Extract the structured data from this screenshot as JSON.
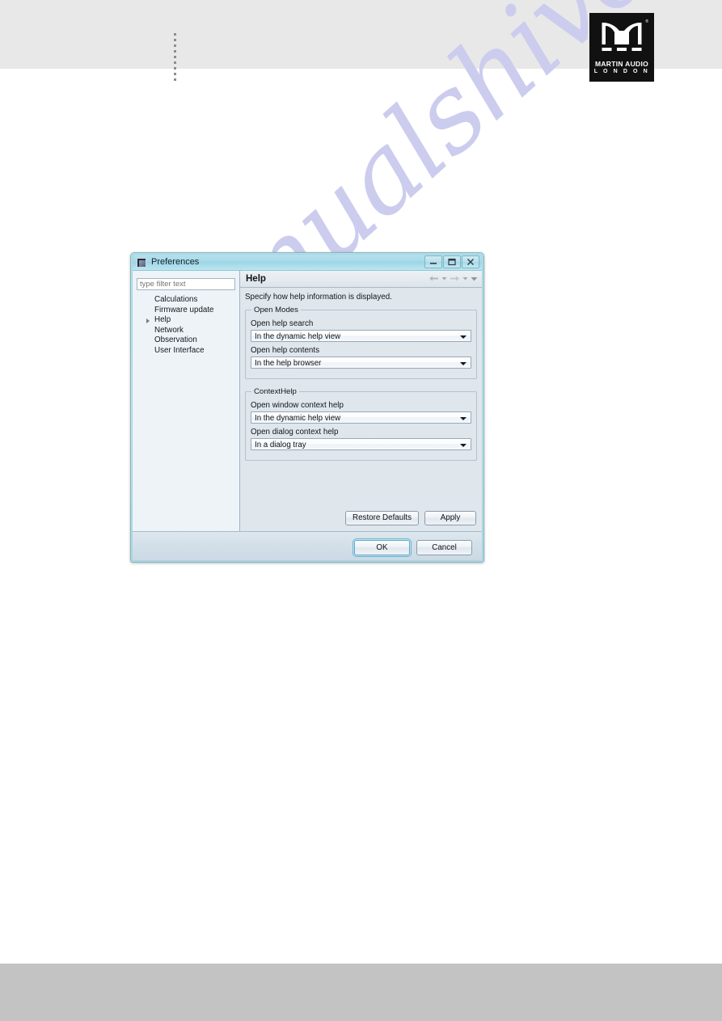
{
  "page": {
    "logo": {
      "brand": "MARTIN AUDIO",
      "city": "L O N D O N",
      "registered_mark": "®"
    },
    "watermark": "manualshive.com"
  },
  "dialog": {
    "title": "Preferences",
    "window_buttons": [
      {
        "name": "minimize",
        "label": "Minimize"
      },
      {
        "name": "maximize",
        "label": "Maximize"
      },
      {
        "name": "close",
        "label": "Close"
      }
    ],
    "sidebar": {
      "filter_placeholder": "type filter text",
      "filter_value": "type filter text",
      "items": [
        {
          "label": "Calculations",
          "expandable": false,
          "selected": false
        },
        {
          "label": "Firmware update",
          "expandable": false,
          "selected": false
        },
        {
          "label": "Help",
          "expandable": true,
          "selected": true
        },
        {
          "label": "Network",
          "expandable": false,
          "selected": false
        },
        {
          "label": "Observation",
          "expandable": false,
          "selected": false
        },
        {
          "label": "User Interface",
          "expandable": false,
          "selected": false
        }
      ]
    },
    "page": {
      "title": "Help",
      "description": "Specify how help information is displayed.",
      "groups": [
        {
          "legend": "Open Modes",
          "fields": [
            {
              "label": "Open help search",
              "value": "In the dynamic help view"
            },
            {
              "label": "Open help contents",
              "value": "In the help browser"
            }
          ]
        },
        {
          "legend": "ContextHelp",
          "fields": [
            {
              "label": "Open window context help",
              "value": "In the dynamic help view"
            },
            {
              "label": "Open dialog context help",
              "value": "In a dialog tray"
            }
          ]
        }
      ],
      "apply_buttons": [
        {
          "name": "restore-defaults",
          "label": "Restore Defaults"
        },
        {
          "name": "apply",
          "label": "Apply"
        }
      ]
    },
    "footer_buttons": [
      {
        "name": "ok",
        "label": "OK",
        "default": true
      },
      {
        "name": "cancel",
        "label": "Cancel",
        "default": false
      }
    ]
  }
}
